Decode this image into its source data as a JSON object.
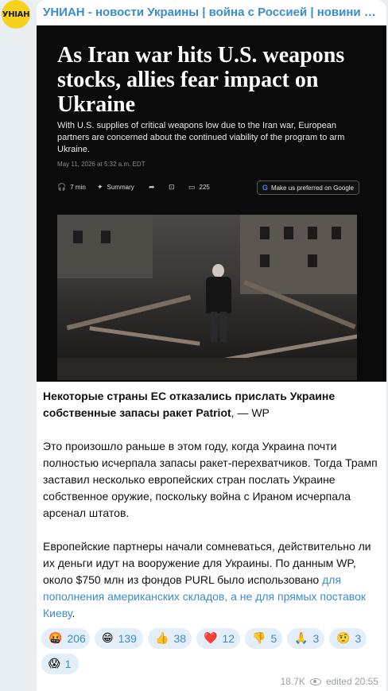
{
  "channel": {
    "avatar_text": "УНІАН",
    "title": "УНИАН - новости Украины | война с Россией | новини України"
  },
  "article": {
    "headline": "As Iran war hits U.S. weapons stocks, allies fear impact on Ukraine",
    "subheadline": "With U.S. supplies of critical weapons low due to the Iran war, European partners are concerned about the continued viability of the program to arm Ukraine.",
    "date": "May 11, 2026 at 5:32 a.m. EDT",
    "read_time": "7 min",
    "summary_label": "Summary",
    "comments_count": "225",
    "google_cta": "Make us preferred on Google",
    "icons": [
      "headphones-icon",
      "sparkle-icon",
      "bookmark-icon",
      "comment-icon",
      "google-icon"
    ]
  },
  "post": {
    "lead_bold": "Некоторые страны ЕС отказались прислать Украине собственные запасы ракет Patriot",
    "lead_suffix": ", — WP",
    "paragraph_2": "Это произошло раньше в этом году, когда Украина почти полностью исчерпала запасы ракет-перехватчиков. Тогда Трамп заставил несколько европейских стран послать Украине собственное оружие, поскольку война с Ираном исчерпала арсенал штатов.",
    "paragraph_3": "Европейские партнеры начали сомневаться, действительно ли их деньги идут на вооружение для Украины. По данным WP, около $750 млн из фондов PURL было использовано ",
    "paragraph_3_link": "для пополнения американских складов, а не для прямых поставок Киеву",
    "paragraph_3_end": "."
  },
  "reactions": [
    {
      "emoji": "🤬",
      "name": "swearing-face",
      "count": "206"
    },
    {
      "emoji": "😁",
      "name": "grinning-face",
      "count": "139"
    },
    {
      "emoji": "👍",
      "name": "thumbs-up",
      "count": "38"
    },
    {
      "emoji": "❤️",
      "name": "red-heart",
      "count": "12"
    },
    {
      "emoji": "👎",
      "name": "thumbs-down",
      "count": "5"
    },
    {
      "emoji": "🙏",
      "name": "folded-hands",
      "count": "3"
    },
    {
      "emoji": "🤨",
      "name": "raised-eyebrow-face",
      "count": "3"
    },
    {
      "emoji": "😱",
      "name": "screaming-face",
      "count": "1"
    }
  ],
  "footer": {
    "views": "18.7K",
    "edited_time": "edited  20:55"
  },
  "colors": {
    "link": "#3a8ccf",
    "reaction_bg": "#e3eef8",
    "avatar_bg": "#f6d21f",
    "chat_bg": "#e8eef2"
  }
}
